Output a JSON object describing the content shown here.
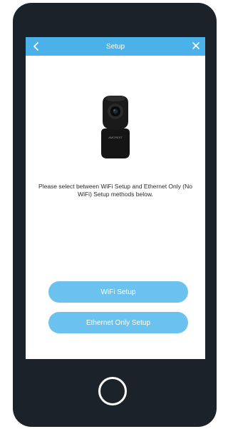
{
  "header": {
    "title": "Setup",
    "back_icon": "chevron-left-icon",
    "close_icon": "close-icon"
  },
  "content": {
    "description": "Please select between WiFi Setup and Ethernet Only (No WiFi) Setup methods below.",
    "camera_brand": "AMCREST"
  },
  "buttons": {
    "wifi_label": "WiFi Setup",
    "ethernet_label": "Ethernet Only Setup"
  },
  "colors": {
    "header": "#4ab2e8",
    "button": "#6cc2ee",
    "phone_frame": "#1c222a"
  }
}
